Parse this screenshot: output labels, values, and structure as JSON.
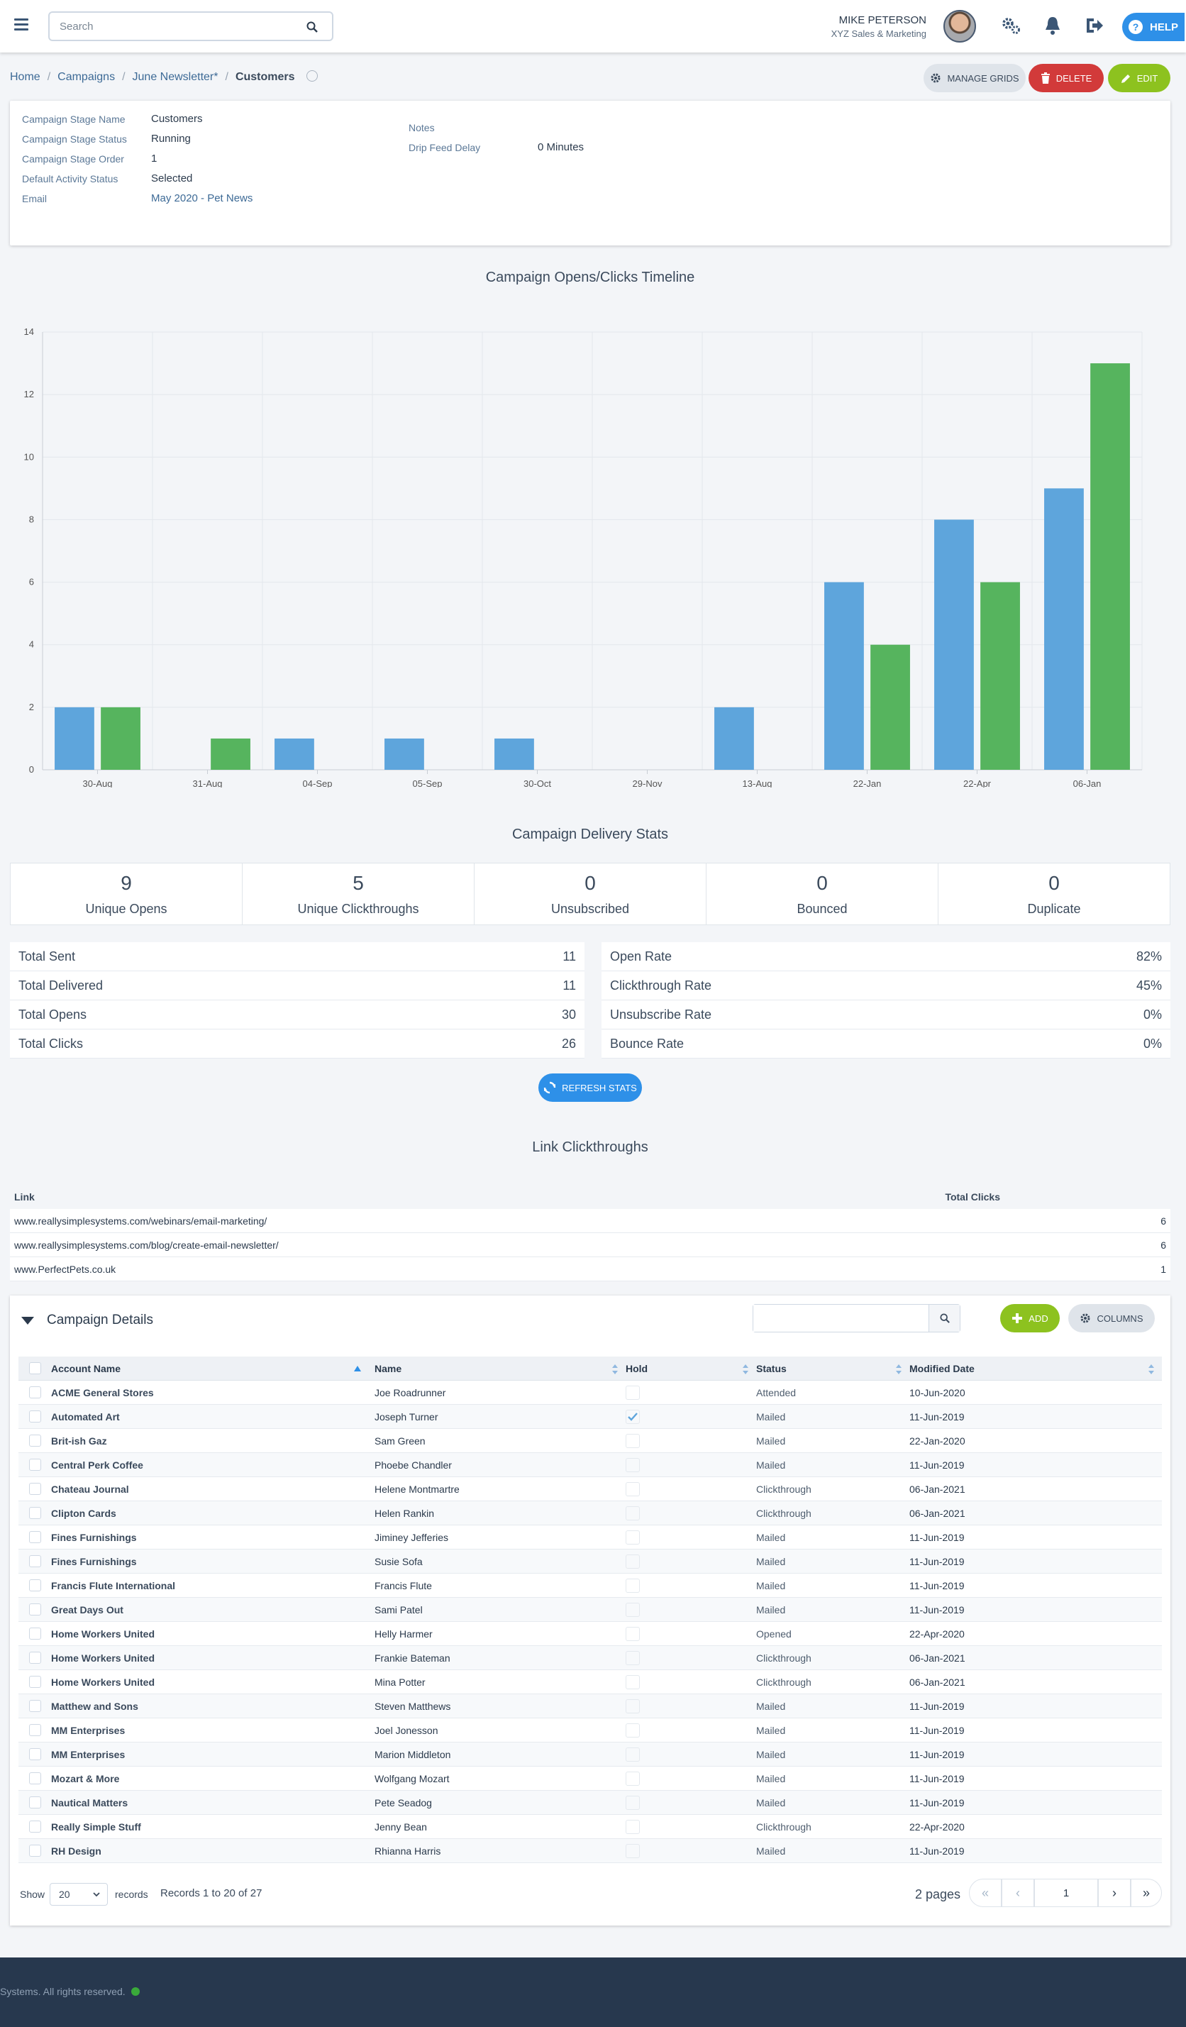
{
  "topbar": {
    "search_placeholder": "Search",
    "user_name": "MIKE PETERSON",
    "company": "XYZ Sales & Marketing",
    "help_label": "HELP"
  },
  "breadcrumb": {
    "items": [
      "Home",
      "Campaigns",
      "June Newsletter*"
    ],
    "current": "Customers"
  },
  "actions": {
    "manage_grids": "MANAGE GRIDS",
    "delete": "DELETE",
    "edit": "EDIT"
  },
  "details": {
    "stage_name_label": "Campaign Stage Name",
    "stage_name": "Customers",
    "stage_status_label": "Campaign Stage Status",
    "stage_status": "Running",
    "stage_order_label": "Campaign Stage Order",
    "stage_order": "1",
    "default_activity_label": "Default Activity Status",
    "default_activity": "Selected",
    "email_label": "Email",
    "email": "May 2020 - Pet News",
    "notes_label": "Notes",
    "drip_label": "Drip Feed Delay",
    "drip": "0 Minutes"
  },
  "chart_title": "Campaign Opens/Clicks Timeline",
  "chart_data": {
    "type": "bar",
    "categories": [
      "30-Aug",
      "31-Aug",
      "04-Sep",
      "05-Sep",
      "30-Oct",
      "29-Nov",
      "13-Aug",
      "22-Jan",
      "22-Apr",
      "06-Jan"
    ],
    "series": [
      {
        "values": [
          2,
          0,
          1,
          1,
          1,
          0,
          2,
          6,
          8,
          9
        ],
        "color": "#5ea5dc"
      },
      {
        "values": [
          2,
          1,
          0,
          0,
          0,
          0,
          0,
          4,
          6,
          13
        ],
        "color": "#56b45e"
      }
    ],
    "ylim": [
      0,
      14
    ],
    "yticks": [
      0,
      2,
      4,
      6,
      8,
      10,
      12,
      14
    ],
    "grid": true
  },
  "delivery_title": "Campaign Delivery Stats",
  "stats": [
    {
      "value": "9",
      "label": "Unique Opens"
    },
    {
      "value": "5",
      "label": "Unique Clickthroughs"
    },
    {
      "value": "0",
      "label": "Unsubscribed"
    },
    {
      "value": "0",
      "label": "Bounced"
    },
    {
      "value": "0",
      "label": "Duplicate"
    }
  ],
  "totals_left": [
    {
      "label": "Total Sent",
      "value": "11"
    },
    {
      "label": "Total Delivered",
      "value": "11"
    },
    {
      "label": "Total Opens",
      "value": "30"
    },
    {
      "label": "Total Clicks",
      "value": "26"
    }
  ],
  "totals_right": [
    {
      "label": "Open Rate",
      "value": "82%"
    },
    {
      "label": "Clickthrough Rate",
      "value": "45%"
    },
    {
      "label": "Unsubscribe Rate",
      "value": "0%"
    },
    {
      "label": "Bounce Rate",
      "value": "0%"
    }
  ],
  "refresh_label": "REFRESH STATS",
  "links_title": "Link Clickthroughs",
  "links": {
    "col_link": "Link",
    "col_clicks": "Total Clicks",
    "rows": [
      {
        "url": "www.reallysimplesystems.com/webinars/email-marketing/",
        "clicks": "6"
      },
      {
        "url": "www.reallysimplesystems.com/blog/create-email-newsletter/",
        "clicks": "6"
      },
      {
        "url": "www.PerfectPets.co.uk",
        "clicks": "1"
      }
    ]
  },
  "campaign_details": {
    "title": "Campaign Details",
    "add_label": "ADD",
    "columns_label": "COLUMNS",
    "headers": {
      "account": "Account Name",
      "name": "Name",
      "hold": "Hold",
      "status": "Status",
      "modified": "Modified Date"
    },
    "rows": [
      {
        "account": "ACME General Stores",
        "name": "Joe Roadrunner",
        "hold": false,
        "status": "Attended",
        "modified": "10-Jun-2020"
      },
      {
        "account": "Automated Art",
        "name": "Joseph Turner",
        "hold": true,
        "status": "Mailed",
        "modified": "11-Jun-2019"
      },
      {
        "account": "Brit-ish Gaz",
        "name": "Sam Green",
        "hold": false,
        "status": "Mailed",
        "modified": "22-Jan-2020"
      },
      {
        "account": "Central Perk Coffee",
        "name": "Phoebe Chandler",
        "hold": false,
        "status": "Mailed",
        "modified": "11-Jun-2019"
      },
      {
        "account": "Chateau Journal",
        "name": "Helene Montmartre",
        "hold": false,
        "status": "Clickthrough",
        "modified": "06-Jan-2021"
      },
      {
        "account": "Clipton Cards",
        "name": "Helen Rankin",
        "hold": false,
        "status": "Clickthrough",
        "modified": "06-Jan-2021"
      },
      {
        "account": "Fines Furnishings",
        "name": "Jiminey Jefferies",
        "hold": false,
        "status": "Mailed",
        "modified": "11-Jun-2019"
      },
      {
        "account": "Fines Furnishings",
        "name": "Susie Sofa",
        "hold": false,
        "status": "Mailed",
        "modified": "11-Jun-2019"
      },
      {
        "account": "Francis Flute International",
        "name": "Francis Flute",
        "hold": false,
        "status": "Mailed",
        "modified": "11-Jun-2019"
      },
      {
        "account": "Great Days Out",
        "name": "Sami Patel",
        "hold": false,
        "status": "Mailed",
        "modified": "11-Jun-2019"
      },
      {
        "account": "Home Workers United",
        "name": "Helly Harmer",
        "hold": false,
        "status": "Opened",
        "modified": "22-Apr-2020"
      },
      {
        "account": "Home Workers United",
        "name": "Frankie Bateman",
        "hold": false,
        "status": "Clickthrough",
        "modified": "06-Jan-2021"
      },
      {
        "account": "Home Workers United",
        "name": "Mina Potter",
        "hold": false,
        "status": "Clickthrough",
        "modified": "06-Jan-2021"
      },
      {
        "account": "Matthew and Sons",
        "name": "Steven Matthews",
        "hold": false,
        "status": "Mailed",
        "modified": "11-Jun-2019"
      },
      {
        "account": "MM Enterprises",
        "name": "Joel Jonesson",
        "hold": false,
        "status": "Mailed",
        "modified": "11-Jun-2019"
      },
      {
        "account": "MM Enterprises",
        "name": "Marion Middleton",
        "hold": false,
        "status": "Mailed",
        "modified": "11-Jun-2019"
      },
      {
        "account": "Mozart & More",
        "name": "Wolfgang Mozart",
        "hold": false,
        "status": "Mailed",
        "modified": "11-Jun-2019"
      },
      {
        "account": "Nautical Matters",
        "name": "Pete Seadog",
        "hold": false,
        "status": "Mailed",
        "modified": "11-Jun-2019"
      },
      {
        "account": "Really Simple Stuff",
        "name": "Jenny Bean",
        "hold": false,
        "status": "Clickthrough",
        "modified": "22-Apr-2020"
      },
      {
        "account": "RH Design",
        "name": "Rhianna Harris",
        "hold": false,
        "status": "Mailed",
        "modified": "11-Jun-2019"
      }
    ],
    "pager": {
      "show_label": "Show",
      "page_size": "20",
      "records_label": "records",
      "records_text": "Records 1 to 20 of 27",
      "pages_text": "2 pages",
      "current_page": "1"
    }
  },
  "footer": {
    "text": "Systems. All rights reserved."
  }
}
